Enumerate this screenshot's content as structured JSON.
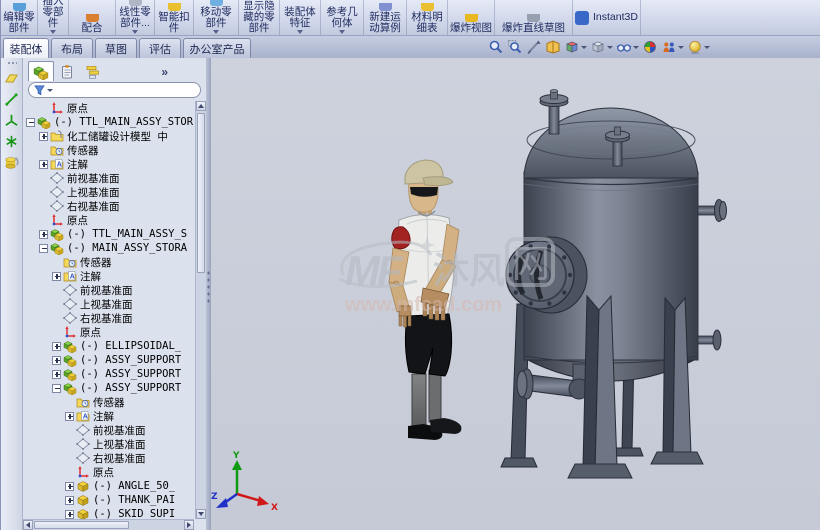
{
  "toolbar": {
    "buttons": [
      {
        "label": "编辑零部件",
        "icon_color": "#5aa0d8"
      },
      {
        "label": "插入零部件",
        "arrow": true,
        "icon_color": "#d8a040"
      },
      {
        "label": "配合",
        "icon_color": "#d87f30"
      },
      {
        "label": "线性零部件...",
        "arrow": true,
        "icon_color": "#aeb6c6"
      },
      {
        "label": "智能扣件",
        "icon_color": "#e8c030"
      },
      {
        "label": "移动零部件",
        "arrow": true,
        "icon_color": "#70b0e0"
      },
      {
        "label": "显示隐藏的零部件",
        "icon_color": "#e8c030"
      },
      {
        "label": "装配体特征",
        "arrow": true
      },
      {
        "label": "参考几何体",
        "arrow": true
      },
      {
        "label": "新建运动算例",
        "icon_color": "#8090d0"
      },
      {
        "label": "材料明细表",
        "icon_color": "#e8c030"
      },
      {
        "label": "爆炸视图",
        "icon_color": "#e8b820"
      },
      {
        "label": "爆炸直线草图",
        "icon_color": "#98a0b0"
      },
      {
        "label": "Instant3D",
        "icon_color": "#3868c8",
        "style_class": "wide"
      }
    ]
  },
  "ribbon_tabs": [
    {
      "label": "装配体",
      "state": "active"
    },
    {
      "label": "布局"
    },
    {
      "label": "草图"
    },
    {
      "label": "评估"
    },
    {
      "label": "办公室产品"
    }
  ],
  "headsup": {
    "items": [
      {
        "name": "zoom-fit"
      },
      {
        "name": "zoom-area"
      },
      {
        "name": "previous-view"
      },
      {
        "name": "section-view"
      },
      {
        "name": "view-orientation",
        "arrow": true
      },
      {
        "name": "display-style",
        "arrow": true
      },
      {
        "name": "hide-show-items",
        "arrow": true
      },
      {
        "name": "edit-appearance"
      },
      {
        "name": "apply-scene",
        "arrow": true
      },
      {
        "name": "view-settings",
        "arrow": true
      }
    ]
  },
  "left_toolbar": {
    "items": [
      {
        "name": "reference-plane"
      },
      {
        "name": "reference-axis"
      },
      {
        "name": "coordinate-system"
      },
      {
        "name": "reference-point"
      },
      {
        "name": "mate-reference"
      }
    ]
  },
  "panel": {
    "tabs": [
      {
        "name": "fm",
        "state": "active"
      },
      {
        "name": "pm"
      },
      {
        "name": "cm"
      }
    ],
    "more_label": "»",
    "tree": {
      "items": [
        {
          "label": "原点",
          "level": 1,
          "expand": "none",
          "icon": "origin"
        },
        {
          "label": "(-) TTL_MAIN_ASSY_STOR",
          "level": 0,
          "expand": "minus",
          "icon": "assembly"
        },
        {
          "label": "化工储罐设计模型 中",
          "level": 1,
          "expand": "plus",
          "icon": "binder"
        },
        {
          "label": "传感器",
          "level": 1,
          "expand": "none",
          "icon": "sensors"
        },
        {
          "label": "注解",
          "level": 1,
          "expand": "plus",
          "icon": "annotations"
        },
        {
          "label": "前视基准面",
          "level": 1,
          "expand": "none",
          "icon": "plane"
        },
        {
          "label": "上视基准面",
          "level": 1,
          "expand": "none",
          "icon": "plane"
        },
        {
          "label": "右视基准面",
          "level": 1,
          "expand": "none",
          "icon": "plane"
        },
        {
          "label": "原点",
          "level": 1,
          "expand": "none",
          "icon": "origin"
        },
        {
          "label": "(-) TTL_MAIN_ASSY_S",
          "level": 1,
          "expand": "plus",
          "icon": "assembly"
        },
        {
          "label": "(-) MAIN_ASSY_STORA",
          "level": 1,
          "expand": "minus",
          "icon": "assembly"
        },
        {
          "label": "传感器",
          "level": 2,
          "expand": "none",
          "icon": "sensors"
        },
        {
          "label": "注解",
          "level": 2,
          "expand": "plus",
          "icon": "annotations"
        },
        {
          "label": "前视基准面",
          "level": 2,
          "expand": "none",
          "icon": "plane"
        },
        {
          "label": "上视基准面",
          "level": 2,
          "expand": "none",
          "icon": "plane"
        },
        {
          "label": "右视基准面",
          "level": 2,
          "expand": "none",
          "icon": "plane"
        },
        {
          "label": "原点",
          "level": 2,
          "expand": "none",
          "icon": "origin"
        },
        {
          "label": "(-) ELLIPSOIDAL_",
          "level": 2,
          "expand": "plus",
          "icon": "assembly"
        },
        {
          "label": "(-) ASSY_SUPPORT",
          "level": 2,
          "expand": "plus",
          "icon": "assembly"
        },
        {
          "label": "(-) ASSY_SUPPORT",
          "level": 2,
          "expand": "plus",
          "icon": "assembly"
        },
        {
          "label": "(-) ASSY_SUPPORT",
          "level": 2,
          "expand": "minus",
          "icon": "assembly"
        },
        {
          "label": "传感器",
          "level": 3,
          "expand": "none",
          "icon": "sensors"
        },
        {
          "label": "注解",
          "level": 3,
          "expand": "plus",
          "icon": "annotations"
        },
        {
          "label": "前视基准面",
          "level": 3,
          "expand": "none",
          "icon": "plane"
        },
        {
          "label": "上视基准面",
          "level": 3,
          "expand": "none",
          "icon": "plane"
        },
        {
          "label": "右视基准面",
          "level": 3,
          "expand": "none",
          "icon": "plane"
        },
        {
          "label": "原点",
          "level": 3,
          "expand": "none",
          "icon": "origin"
        },
        {
          "label": "(-) ANGLE_50_",
          "level": 3,
          "expand": "plus",
          "icon": "part"
        },
        {
          "label": "(-) THANK_PAI",
          "level": 3,
          "expand": "plus",
          "icon": "part"
        },
        {
          "label": "(-) SKID_SUPI",
          "level": 3,
          "expand": "plus",
          "icon": "part"
        }
      ]
    }
  },
  "viewport": {
    "watermark": {
      "logo": "MF",
      "text_cn": "沐风",
      "boxed_cn": "网",
      "url": "www.mfcad.com"
    },
    "triad": {
      "x": "X",
      "y": "Y",
      "z": "Z"
    },
    "colors": {
      "tank": "#5a6170",
      "figure_shirt": "#ecedeb",
      "figure_patch": "#a32222",
      "background": "#c9ced9"
    }
  }
}
